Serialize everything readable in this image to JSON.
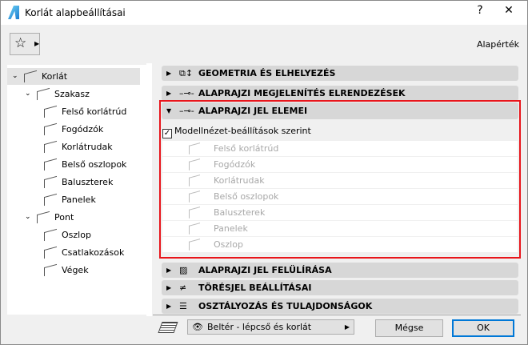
{
  "window": {
    "title": "Korlát alapbeállításai",
    "help": "?",
    "close": "✕"
  },
  "toolbar": {
    "favorites_icon": "star-icon",
    "default_label": "Alapérték"
  },
  "tree": [
    {
      "label": "Korlát",
      "level": 0,
      "expanded": true,
      "selected": true
    },
    {
      "label": "Szakasz",
      "level": 1,
      "expanded": true
    },
    {
      "label": "Felső korlátrúd",
      "level": 2
    },
    {
      "label": "Fogódzók",
      "level": 2
    },
    {
      "label": "Korlátrudak",
      "level": 2
    },
    {
      "label": "Belső oszlopok",
      "level": 2
    },
    {
      "label": "Baluszterek",
      "level": 2
    },
    {
      "label": "Panelek",
      "level": 2
    },
    {
      "label": "Pont",
      "level": 1,
      "expanded": true
    },
    {
      "label": "Oszlop",
      "level": 2
    },
    {
      "label": "Csatlakozások",
      "level": 2
    },
    {
      "label": "Végek",
      "level": 2
    }
  ],
  "sections": [
    {
      "label": "GEOMETRIA ÉS ELHELYEZÉS",
      "icon": "geometry-icon",
      "expanded": false
    },
    {
      "label": "ALAPRAJZI MEGJELENÍTÉS ELRENDEZÉSEK",
      "icon": "floorplan-icon",
      "expanded": false
    },
    {
      "label": "ALAPRAJZI JEL ELEMEI",
      "icon": "floorplan-icon",
      "expanded": true
    },
    {
      "label": "ALAPRAJZI JEL FELÜLÍRÁSA",
      "icon": "override-icon",
      "expanded": false
    },
    {
      "label": "TÖRÉSJEL BEÁLLÍTÁSAI",
      "icon": "break-mark-icon",
      "expanded": false
    },
    {
      "label": "OSZTÁLYOZÁS ÉS TULAJDONSÁGOK",
      "icon": "document-icon",
      "expanded": false
    }
  ],
  "symbol_panel": {
    "checkbox_label": "Modellnézet-beállítások szerint",
    "checked": true,
    "items": [
      "Felső korlátrúd",
      "Fogódzók",
      "Korlátrudak",
      "Belső oszlopok",
      "Baluszterek",
      "Panelek",
      "Oszlop"
    ]
  },
  "footer": {
    "layer": "Beltér - lépcső és korlát",
    "cancel": "Mégse",
    "ok": "OK"
  }
}
